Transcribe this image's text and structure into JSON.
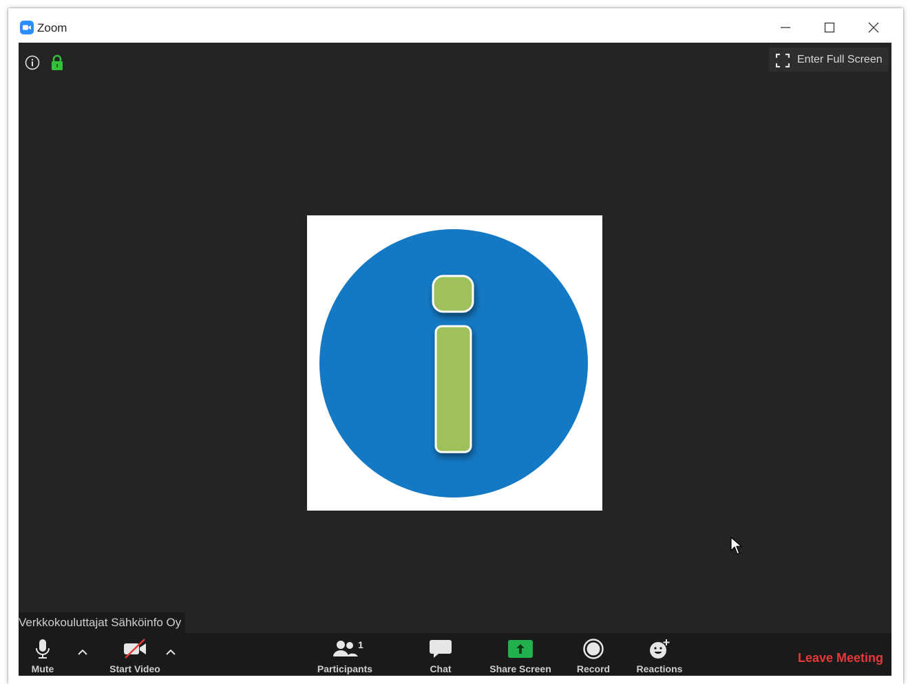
{
  "window": {
    "title": "Zoom",
    "controls": {
      "minimize": "minimize-icon",
      "maximize": "maximize-icon",
      "close": "close-icon"
    }
  },
  "meeting": {
    "fullscreen_label": "Enter Full Screen",
    "participant_name": "Verkkokouluttajat Sähköinfo Oy",
    "tile_image": "info-i-avatar"
  },
  "toolbar": {
    "mute_label": "Mute",
    "video_label": "Start Video",
    "participants_label": "Participants",
    "participants_count": "1",
    "chat_label": "Chat",
    "share_label": "Share Screen",
    "record_label": "Record",
    "reactions_label": "Reactions",
    "leave_label": "Leave Meeting"
  },
  "colors": {
    "video_bg": "#242424",
    "toolbar_bg": "#1a1a1a",
    "share_green": "#22b14c",
    "lock_green": "#31c23a",
    "leave_red": "#e8383a",
    "avatar_blue": "#1479c4",
    "avatar_i_green": "#a0c05c",
    "zoom_blue": "#2d8cff"
  }
}
